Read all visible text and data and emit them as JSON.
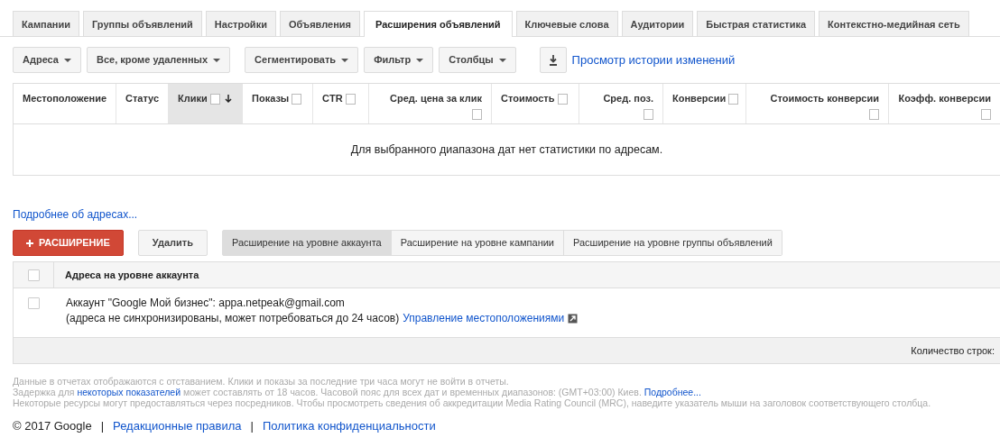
{
  "tabs": [
    {
      "label": "Кампании",
      "selected": false
    },
    {
      "label": "Группы объявлений",
      "selected": false
    },
    {
      "label": "Настройки",
      "selected": false
    },
    {
      "label": "Объявления",
      "selected": false
    },
    {
      "label": "Расширения объявлений",
      "selected": true
    },
    {
      "label": "Ключевые слова",
      "selected": false
    },
    {
      "label": "Аудитории",
      "selected": false
    },
    {
      "label": "Быстрая статистика",
      "selected": false
    },
    {
      "label": "Контекстно-медийная сеть",
      "selected": false
    }
  ],
  "toolbar": {
    "groups": [
      [
        "Адреса",
        "Все, кроме удаленных"
      ],
      [
        "Сегментировать",
        "Фильтр",
        "Столбцы"
      ]
    ],
    "history_link": "Просмотр истории изменений"
  },
  "stats_table": {
    "columns": [
      {
        "label": "Местоположение",
        "kind": "plain",
        "sorted": false
      },
      {
        "label": "Статус",
        "kind": "plain",
        "sorted": false
      },
      {
        "label": "Клики",
        "kind": "inline",
        "sorted": true
      },
      {
        "label": "Показы",
        "kind": "inline",
        "sorted": false
      },
      {
        "label": "CTR",
        "kind": "inline",
        "sorted": false
      },
      {
        "label": "Сред. цена за клик",
        "kind": "stacked",
        "sorted": false
      },
      {
        "label": "Стоимость",
        "kind": "inline",
        "sorted": false
      },
      {
        "label": "Сред. поз.",
        "kind": "stacked",
        "sorted": false
      },
      {
        "label": "Конверсии",
        "kind": "inline",
        "sorted": false
      },
      {
        "label": "Стоимость конверсии",
        "kind": "stacked",
        "sorted": false
      },
      {
        "label": "Коэфф. конверсии",
        "kind": "stacked",
        "sorted": false
      }
    ],
    "empty_message": "Для выбранного диапазона дат нет статистики по адресам."
  },
  "more_link": "Подробнее об адресах...",
  "actions": {
    "add_button": "РАСШИРЕНИЕ",
    "delete_button": "Удалить",
    "levels": [
      {
        "label": "Расширение на уровне аккаунта",
        "selected": true
      },
      {
        "label": "Расширение на уровне кампании",
        "selected": false
      },
      {
        "label": "Расширение на уровне группы объявлений",
        "selected": false
      }
    ]
  },
  "addresses_table": {
    "header": "Адреса на уровне аккаунта",
    "header_checked": false,
    "rows": [
      {
        "checked": false,
        "line1": "Аккаунт \"Google Мой бизнес\": appa.netpeak@gmail.com",
        "line2": "(адреса не синхронизированы, может потребоваться до 24 часов)",
        "link": "Управление местоположениями"
      }
    ],
    "row_count_label": "Количество строк:"
  },
  "notes": [
    [
      {
        "text": "Данные в отчетах отображаются с отставанием. Клики и показы за последние три часа могут не войти в отчеты.",
        "kind": "text"
      }
    ],
    [
      {
        "text": "Задержка для ",
        "kind": "text"
      },
      {
        "text": "некоторых показателей",
        "kind": "link"
      },
      {
        "text": " может составлять от 18 часов. Часовой пояс для всех дат и временных диапазонов: (GMT+03:00) Киев. ",
        "kind": "text"
      },
      {
        "text": "Подробнее...",
        "kind": "link"
      }
    ],
    [
      {
        "text": "Некоторые ресурсы могут предоставляться через посредников. Чтобы просмотреть сведения об аккредитации Media Rating Council (MRC), наведите указатель мыши на заголовок соответствующего столбца.",
        "kind": "text"
      }
    ]
  ],
  "footer": {
    "copyright": "© 2017 Google",
    "separator": "|",
    "links": [
      "Редакционные правила",
      "Политика конфиденциальности"
    ]
  }
}
